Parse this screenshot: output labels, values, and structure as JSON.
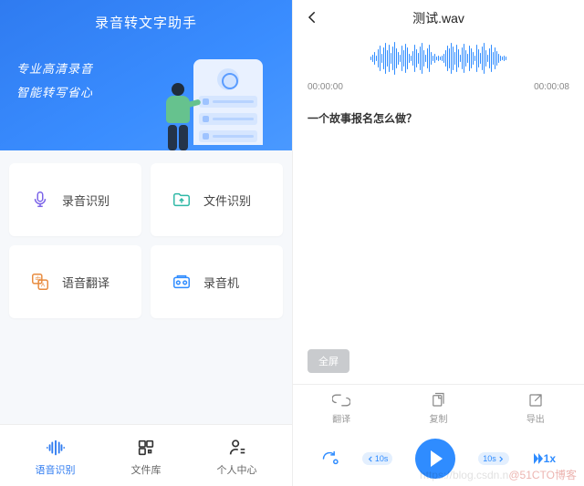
{
  "left": {
    "title": "录音转文字助手",
    "slogan1": "专业高清录音",
    "slogan2": "智能转写省心",
    "cards": [
      {
        "label": "录音识别",
        "icon": "mic-icon",
        "color": "#7a62e8"
      },
      {
        "label": "文件识别",
        "icon": "folder-icon",
        "color": "#2fb8a6"
      },
      {
        "label": "语音翻译",
        "icon": "translate-icon",
        "color": "#e88b3e"
      },
      {
        "label": "录音机",
        "icon": "recorder-icon",
        "color": "#2f8cff"
      }
    ],
    "tabs": [
      {
        "label": "语音识别",
        "icon": "wave-icon",
        "active": true
      },
      {
        "label": "文件库",
        "icon": "grid-icon",
        "active": false
      },
      {
        "label": "个人中心",
        "icon": "person-icon",
        "active": false
      }
    ]
  },
  "right": {
    "title": "测试.wav",
    "time_start": "00:00:00",
    "time_end": "00:00:08",
    "transcript": "一个故事报名怎么做？",
    "fullscreen": "全屏",
    "actions": [
      {
        "label": "翻译",
        "icon": "translate-action-icon"
      },
      {
        "label": "复制",
        "icon": "copy-icon"
      },
      {
        "label": "导出",
        "icon": "export-icon"
      }
    ],
    "player": {
      "seek_back": "10s",
      "seek_fwd": "10s",
      "speed": "1x"
    }
  },
  "watermark": {
    "prefix": "https://blog.csdn.n",
    "brand": "@51CTO博客"
  }
}
